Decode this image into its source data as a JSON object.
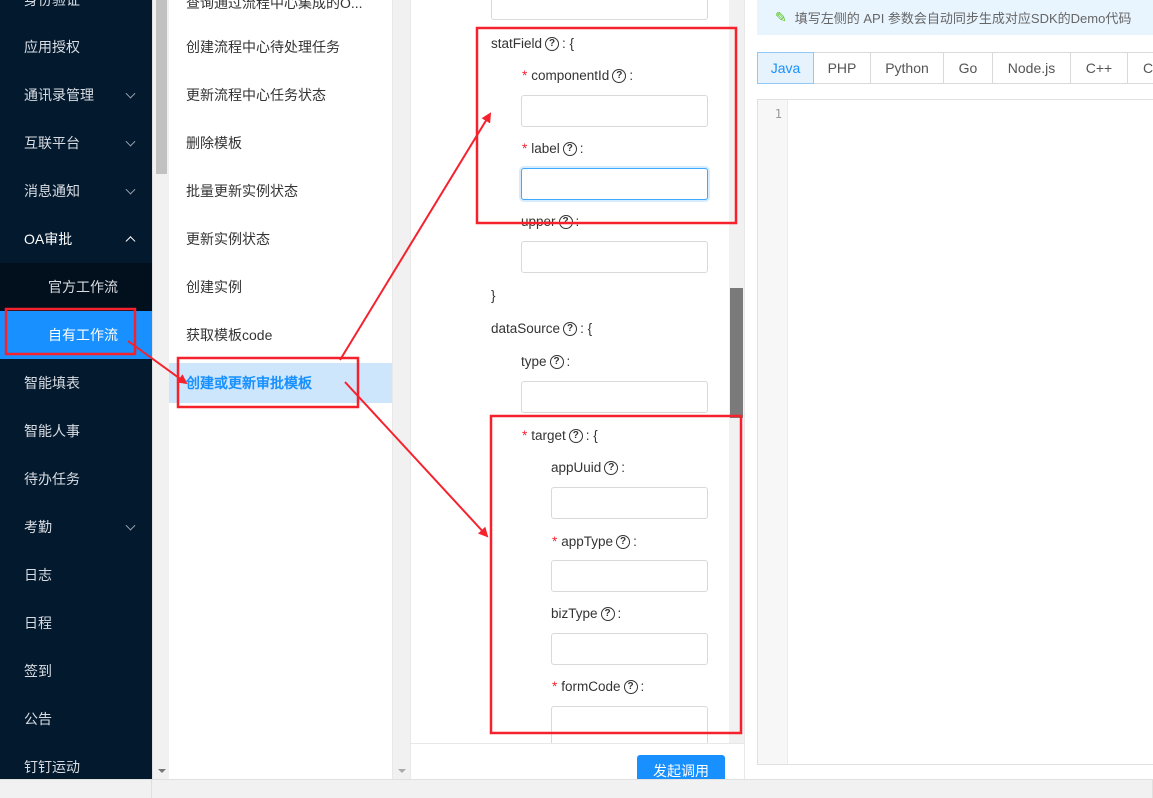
{
  "nav": {
    "items": [
      {
        "label": "身份验证",
        "has_chevron": false
      },
      {
        "label": "应用授权",
        "has_chevron": false
      },
      {
        "label": "通讯录管理",
        "has_chevron": true
      },
      {
        "label": "互联平台",
        "has_chevron": true
      },
      {
        "label": "消息通知",
        "has_chevron": true
      },
      {
        "label": "OA审批",
        "has_chevron": true,
        "expanded": true
      },
      {
        "label": "官方工作流",
        "sub": true
      },
      {
        "label": "自有工作流",
        "sub": true,
        "active": true
      },
      {
        "label": "智能填表",
        "has_chevron": false
      },
      {
        "label": "智能人事",
        "has_chevron": false
      },
      {
        "label": "待办任务",
        "has_chevron": false
      },
      {
        "label": "考勤",
        "has_chevron": true
      },
      {
        "label": "日志",
        "has_chevron": false
      },
      {
        "label": "日程",
        "has_chevron": false
      },
      {
        "label": "签到",
        "has_chevron": false
      },
      {
        "label": "公告",
        "has_chevron": false
      },
      {
        "label": "钉钉运动",
        "has_chevron": false
      }
    ]
  },
  "api_list": {
    "items": [
      {
        "label": "查询通过流程中心集成的O..."
      },
      {
        "label": "创建流程中心待处理任务"
      },
      {
        "label": "更新流程中心任务状态"
      },
      {
        "label": "删除模板"
      },
      {
        "label": "批量更新实例状态"
      },
      {
        "label": "更新实例状态"
      },
      {
        "label": "创建实例"
      },
      {
        "label": "获取模板code"
      },
      {
        "label": "创建或更新审批模板",
        "active": true
      }
    ]
  },
  "form": {
    "statField": {
      "label": "statField",
      "open": ": {",
      "close": "}"
    },
    "componentId": {
      "label": "componentId",
      "required": true,
      "value": ""
    },
    "label": {
      "label": "label",
      "required": true,
      "value": ""
    },
    "upper": {
      "label": "upper",
      "required": false,
      "value": ""
    },
    "dataSource": {
      "label": "dataSource",
      "open": ": {"
    },
    "type": {
      "label": "type",
      "required": false,
      "value": ""
    },
    "target": {
      "label": "target",
      "required": true,
      "open": ": {"
    },
    "appUuid": {
      "label": "appUuid",
      "required": false,
      "value": ""
    },
    "appType": {
      "label": "appType",
      "required": true,
      "value": ""
    },
    "bizType": {
      "label": "bizType",
      "required": false,
      "value": ""
    },
    "formCode": {
      "label": "formCode",
      "required": true,
      "value": ""
    },
    "colon": ":",
    "required_mark": "*",
    "help_glyph": "?",
    "invoke_button": "发起调用"
  },
  "code_panel": {
    "tip": "填写左侧的 API 参数会自动同步生成对应SDK的Demo代码",
    "tabs": [
      "Java",
      "PHP",
      "Python",
      "Go",
      "Node.js",
      "C++",
      "C"
    ],
    "active_tab": "Java",
    "line_numbers": [
      "1"
    ]
  },
  "colors": {
    "nav_bg": "#03192e",
    "accent": "#1890ff",
    "annotation_red": "#f5222d"
  }
}
